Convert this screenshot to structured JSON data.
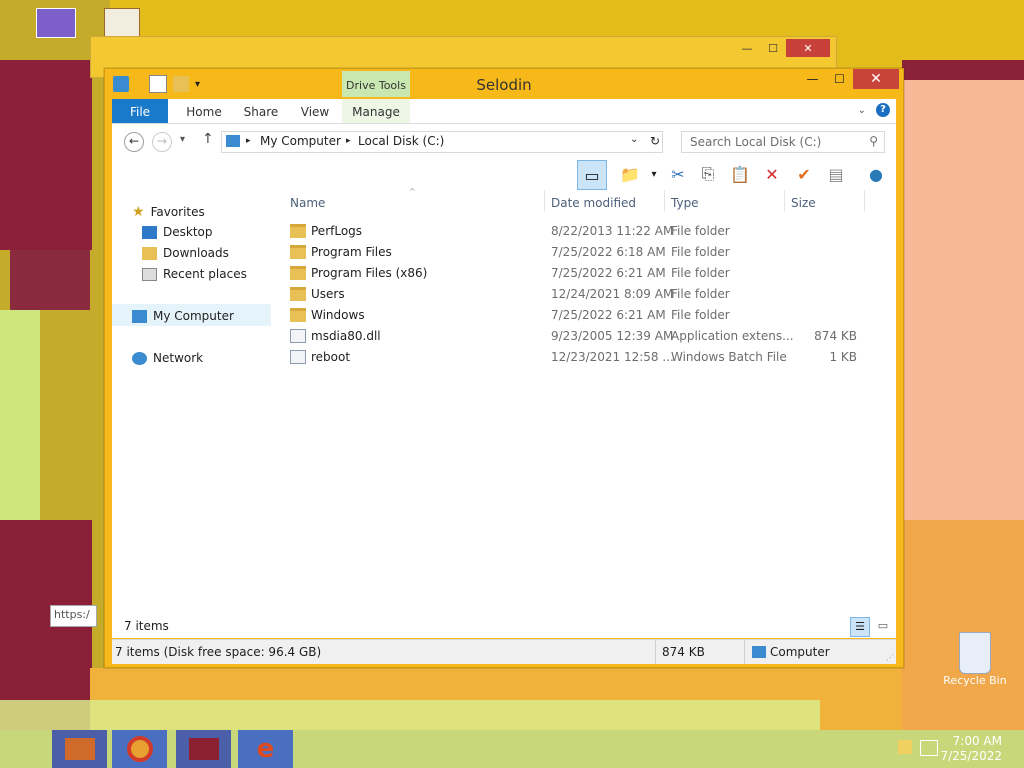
{
  "window": {
    "title": "Selodin",
    "context_tab": "Drive Tools",
    "ribbon_tabs": [
      "File",
      "Home",
      "Share",
      "View",
      "Manage"
    ]
  },
  "address": {
    "crumbs": [
      "My Computer",
      "Local Disk (C:)"
    ],
    "search_placeholder": "Search Local Disk (C:)"
  },
  "nav": {
    "favorites": "Favorites",
    "desktop": "Desktop",
    "downloads": "Downloads",
    "recent": "Recent places",
    "my_computer": "My Computer",
    "network": "Network"
  },
  "columns": [
    "Name",
    "Date modified",
    "Type",
    "Size"
  ],
  "files": [
    {
      "name": "PerfLogs",
      "date": "8/22/2013 11:22 AM",
      "type": "File folder",
      "size": "",
      "icon": "folder-icon"
    },
    {
      "name": "Program Files",
      "date": "7/25/2022 6:18 AM",
      "type": "File folder",
      "size": "",
      "icon": "folder-icon"
    },
    {
      "name": "Program Files (x86)",
      "date": "7/25/2022 6:21 AM",
      "type": "File folder",
      "size": "",
      "icon": "folder-icon"
    },
    {
      "name": "Users",
      "date": "12/24/2021 8:09 AM",
      "type": "File folder",
      "size": "",
      "icon": "folder-icon"
    },
    {
      "name": "Windows",
      "date": "7/25/2022 6:21 AM",
      "type": "File folder",
      "size": "",
      "icon": "folder-icon"
    },
    {
      "name": "msdia80.dll",
      "date": "9/23/2005 12:39 AM",
      "type": "Application extens...",
      "size": "874 KB",
      "icon": "dll-file-icon"
    },
    {
      "name": "reboot",
      "date": "12/23/2021 12:58 ...",
      "type": "Windows Batch File",
      "size": "1 KB",
      "icon": "batch-file-icon"
    }
  ],
  "items_count": "7 items",
  "status": {
    "left": "7 items (Disk free space: 96.4 GB)",
    "size": "874 KB",
    "location": "Computer"
  },
  "desktop": {
    "recycle_bin": "Recycle Bin",
    "url_fragment": "https:/"
  },
  "clock": {
    "time": "7:00 AM",
    "date": "7/25/2022"
  },
  "colors": {
    "window_frame": "#f7b81a",
    "file_tab": "#1979ca",
    "drive_tools": "#c9e7b0",
    "close": "#c8433a"
  }
}
